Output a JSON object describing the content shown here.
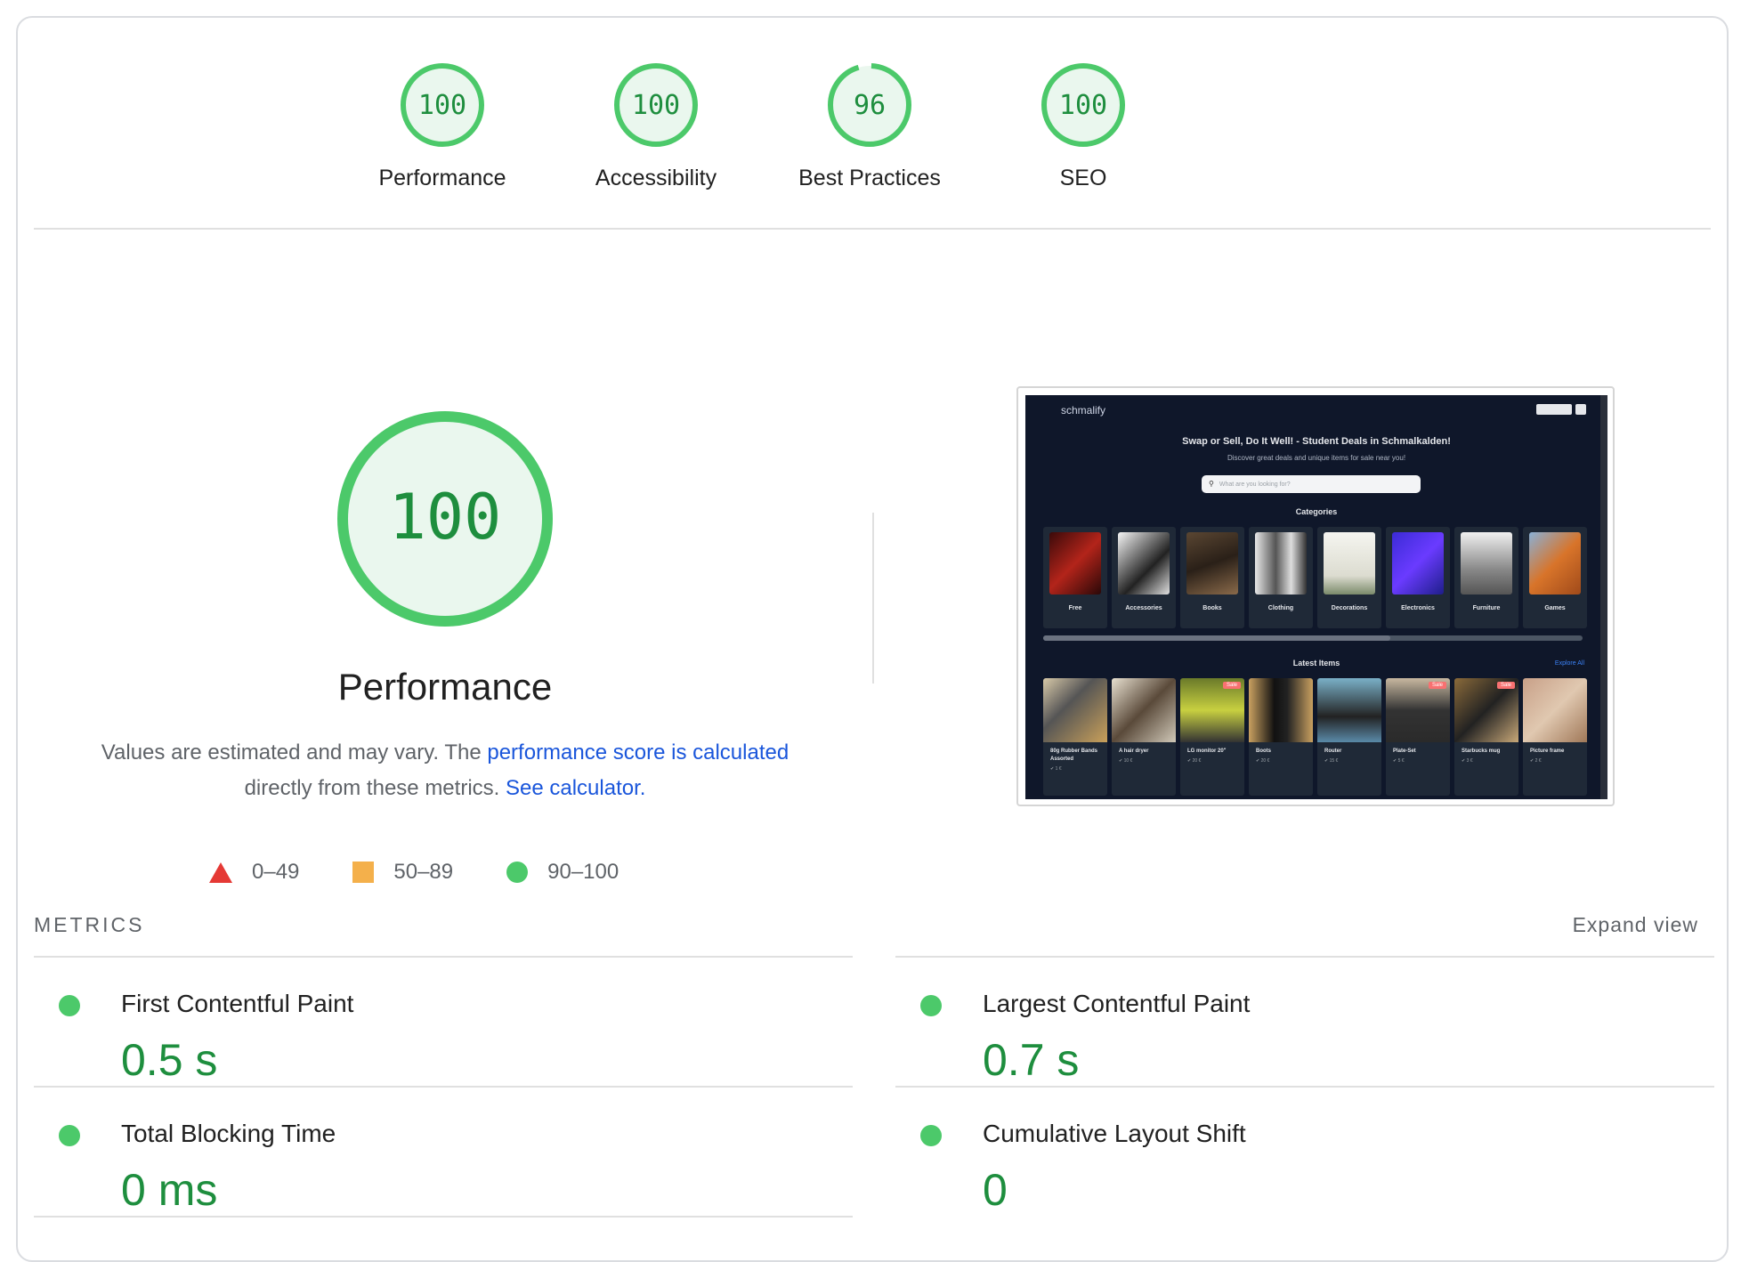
{
  "gauges": [
    {
      "score": "100",
      "label": "Performance",
      "fraction": 1.0
    },
    {
      "score": "100",
      "label": "Accessibility",
      "fraction": 1.0
    },
    {
      "score": "96",
      "label": "Best Practices",
      "fraction": 0.96
    },
    {
      "score": "100",
      "label": "SEO",
      "fraction": 1.0
    }
  ],
  "performance": {
    "score": "100",
    "title": "Performance",
    "desc_prefix": "Values are estimated and may vary. The",
    "desc_link1": "performance score is calculated",
    "desc_middle": "directly from these metrics.",
    "desc_link2": "See calculator."
  },
  "legend": {
    "fail": "0–49",
    "average": "50–89",
    "pass": "90–100"
  },
  "colors": {
    "pass": "#4cc96a",
    "pass_text": "#1e8e3e",
    "average": "#f4b04b",
    "fail": "#e53935",
    "link": "#1a56db"
  },
  "screenshot": {
    "logo": "schmalify",
    "headline": "Swap or Sell, Do It Well! - Student Deals in Schmalkalden!",
    "subheadline": "Discover great deals and unique items for sale near you!",
    "search_placeholder": "What are you looking for?",
    "categories_title": "Categories",
    "categories": [
      "Free",
      "Accessories",
      "Books",
      "Clothing",
      "Decorations",
      "Electronics",
      "Furniture",
      "Games"
    ],
    "latest_title": "Latest Items",
    "explore": "Explore All",
    "items": [
      {
        "name": "80g Rubber Bands Assorted",
        "badge": ""
      },
      {
        "name": "A hair dryer",
        "badge": ""
      },
      {
        "name": "LG monitor 20\"",
        "badge": "Sale"
      },
      {
        "name": "Boots",
        "badge": ""
      },
      {
        "name": "Router",
        "badge": ""
      },
      {
        "name": "Plate-Set",
        "badge": "Sale"
      },
      {
        "name": "Starbucks mug",
        "badge": "Sale"
      },
      {
        "name": "Picture frame",
        "badge": ""
      }
    ]
  },
  "metrics": {
    "header": "METRICS",
    "expand": "Expand view",
    "items": [
      {
        "name": "First Contentful Paint",
        "value": "0.5 s"
      },
      {
        "name": "Largest Contentful Paint",
        "value": "0.7 s"
      },
      {
        "name": "Total Blocking Time",
        "value": "0 ms"
      },
      {
        "name": "Cumulative Layout Shift",
        "value": "0"
      }
    ]
  }
}
